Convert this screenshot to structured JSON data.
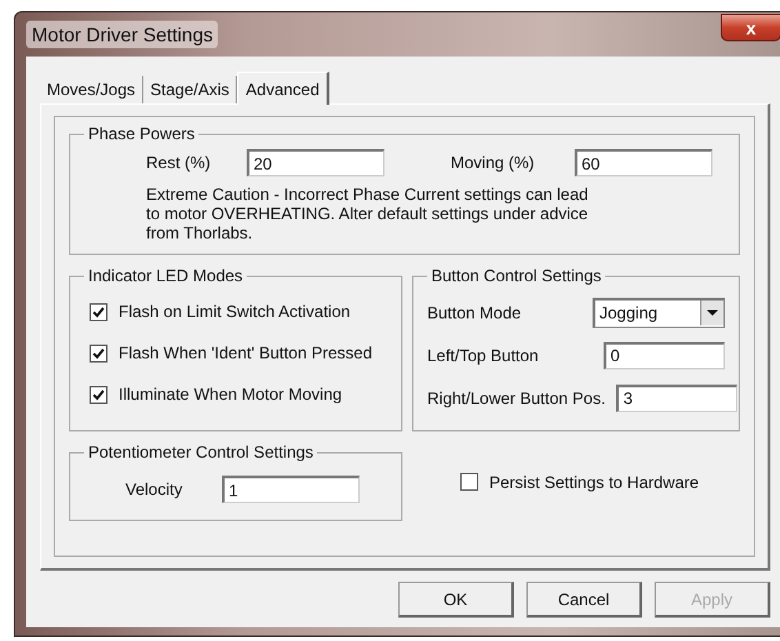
{
  "window": {
    "title": "Motor Driver Settings",
    "close": "x"
  },
  "tabs": [
    {
      "label": "Moves/Jogs",
      "selected": false
    },
    {
      "label": "Stage/Axis",
      "selected": false
    },
    {
      "label": "Advanced",
      "selected": true
    }
  ],
  "phase_powers": {
    "title": "Phase Powers",
    "rest_label": "Rest (%)",
    "rest_value": "20",
    "moving_label": "Moving (%)",
    "moving_value": "60",
    "caution": "Extreme Caution - Incorrect Phase Current settings can lead to motor OVERHEATING. Alter default settings under advice from Thorlabs."
  },
  "indicator_led": {
    "title": "Indicator LED Modes",
    "options": [
      {
        "label": "Flash on Limit Switch Activation",
        "checked": true
      },
      {
        "label": "Flash When 'Ident' Button Pressed",
        "checked": true
      },
      {
        "label": "Illuminate When Motor Moving",
        "checked": true
      }
    ]
  },
  "button_control": {
    "title": "Button Control Settings",
    "fields": [
      {
        "kind": "select",
        "label": "Button Mode",
        "value": "Jogging"
      },
      {
        "kind": "input",
        "label": "Left/Top Button",
        "value": "0"
      },
      {
        "kind": "input",
        "label": "Right/Lower Button Pos.",
        "value": "3"
      }
    ]
  },
  "potentiometer": {
    "title": "Potentiometer Control Settings",
    "velocity_label": "Velocity",
    "velocity_value": "1"
  },
  "persist": {
    "label": "Persist Settings to Hardware",
    "checked": false
  },
  "buttons": [
    {
      "label": "OK",
      "disabled": false
    },
    {
      "label": "Cancel",
      "disabled": false
    },
    {
      "label": "Apply",
      "disabled": true
    }
  ]
}
